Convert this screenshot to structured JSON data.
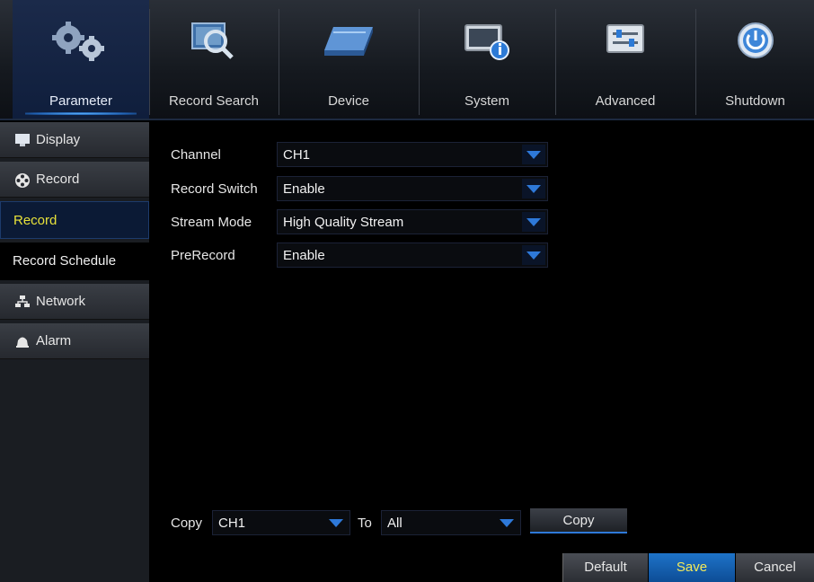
{
  "nav": {
    "tabs": [
      {
        "label": "Parameter",
        "icon": "gears-icon"
      },
      {
        "label": "Record Search",
        "icon": "magnifier-icon"
      },
      {
        "label": "Device",
        "icon": "hard-drive-icon"
      },
      {
        "label": "System",
        "icon": "monitor-info-icon"
      },
      {
        "label": "Advanced",
        "icon": "sliders-icon"
      },
      {
        "label": "Shutdown",
        "icon": "power-icon"
      }
    ]
  },
  "sidebar": {
    "items": [
      {
        "label": "Display",
        "type": "category"
      },
      {
        "label": "Record",
        "type": "category"
      },
      {
        "label": "Record",
        "type": "sub",
        "selected": true
      },
      {
        "label": "Record Schedule",
        "type": "sub"
      },
      {
        "label": "Network",
        "type": "category"
      },
      {
        "label": "Alarm",
        "type": "category"
      }
    ]
  },
  "form": {
    "channel_label": "Channel",
    "channel_value": "CH1",
    "record_switch_label": "Record Switch",
    "record_switch_value": "Enable",
    "stream_mode_label": "Stream Mode",
    "stream_mode_value": "High Quality Stream",
    "prerecord_label": "PreRecord",
    "prerecord_value": "Enable"
  },
  "copy": {
    "copy_label": "Copy",
    "from_value": "CH1",
    "to_label": "To",
    "to_value": "All",
    "button_label": "Copy"
  },
  "footer": {
    "default_label": "Default",
    "save_label": "Save",
    "cancel_label": "Cancel"
  },
  "colors": {
    "accent_blue": "#2e79d9",
    "selected_text": "#e8e23a",
    "save_text": "#f4ea5a"
  }
}
